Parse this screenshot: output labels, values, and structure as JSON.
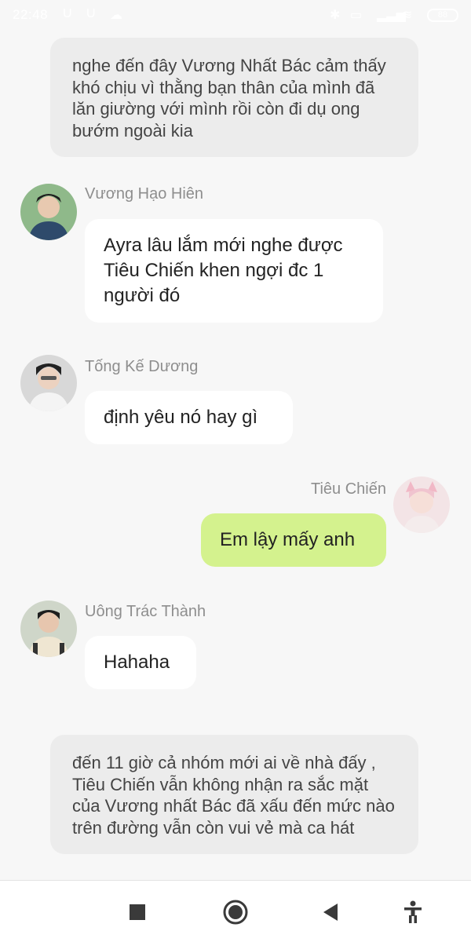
{
  "status_bar": {
    "time": "22:48",
    "battery": "88"
  },
  "narration_top": "nghe đến đây Vương Nhất Bác cảm thấy khó chịu vì thằng bạn thân của mình đã lăn giường với mình rồi còn đi dụ ong bướm ngoài kia",
  "messages": [
    {
      "sender": "Vương Hạo Hiên",
      "text": "Ayra lâu lắm mới nghe được Tiêu Chiến khen ngợi đc 1 người đó"
    },
    {
      "sender": "Tống Kế Dương",
      "text": "định yêu nó hay gì"
    },
    {
      "sender": "Tiêu Chiến",
      "text": "Em lậy mấy anh"
    },
    {
      "sender": "Uông Trác Thành",
      "text": "Hahaha"
    }
  ],
  "narration_bottom": "đến 11 giờ cả nhóm mới ai về nhà đấy , Tiêu Chiến vẫn không nhận ra sắc mặt của Vương nhất Bác đã xấu đến mức nào trên đường vẫn còn vui vẻ mà ca hát",
  "icons": {
    "nav_recent": "square-icon",
    "nav_home": "circle-home-icon",
    "nav_back": "back-triangle-icon",
    "nav_accessibility": "accessibility-icon"
  },
  "colors": {
    "my_bubble": "#d4f28e",
    "other_bubble": "#ffffff",
    "narration_bg": "#ececec"
  }
}
